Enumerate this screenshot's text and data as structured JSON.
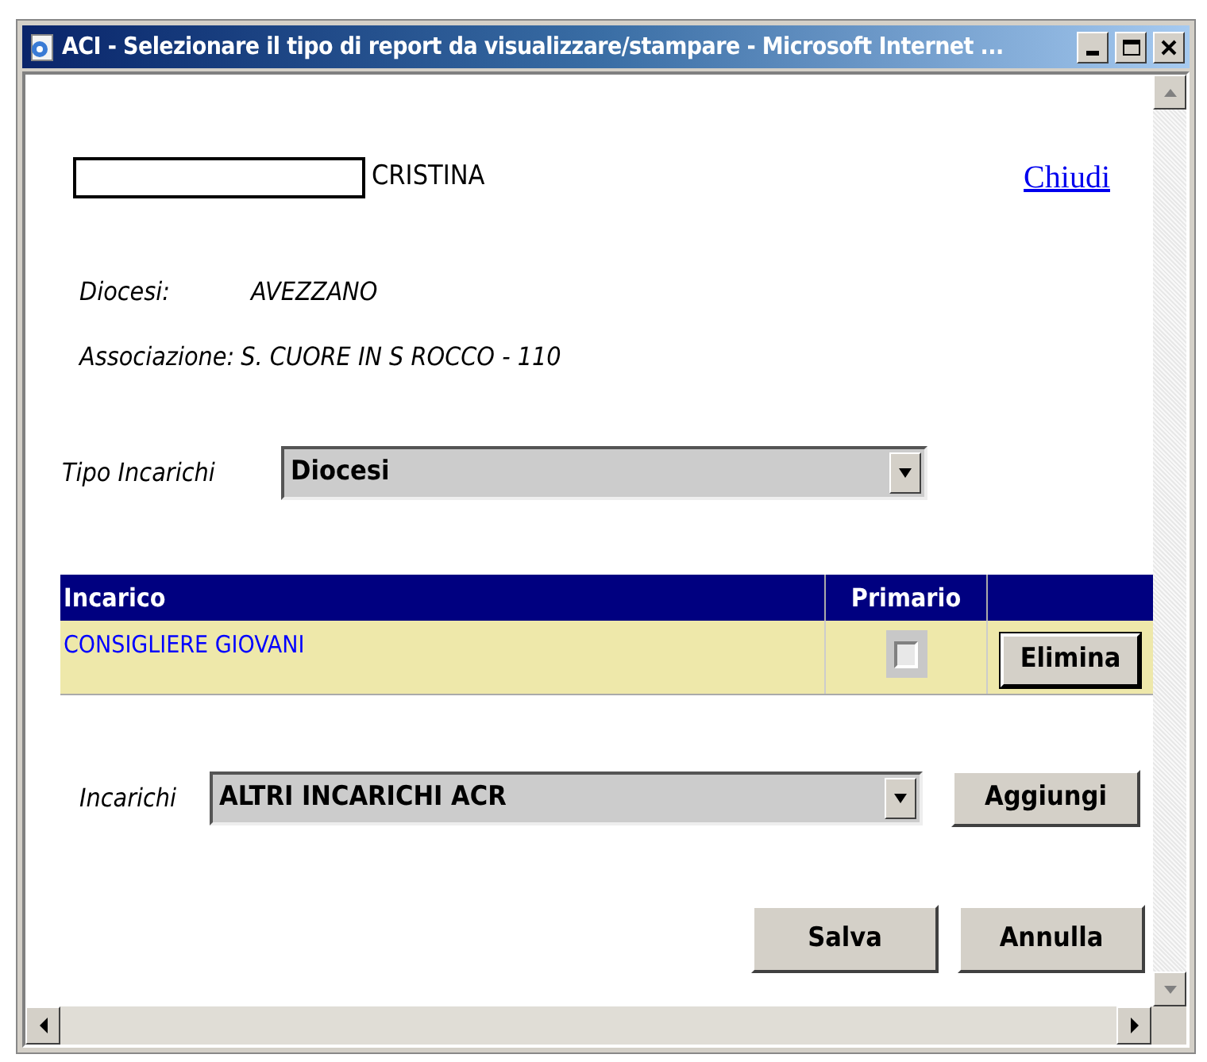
{
  "window": {
    "title": "ACI - Selezionare il tipo di report da visualizzare/stampare - Microsoft Internet ..."
  },
  "person": {
    "first_name": "CRISTINA"
  },
  "close_link": "Chiudi",
  "info": [
    {
      "label": "Diocesi:",
      "value": "AVEZZANO"
    },
    {
      "label": "Associazione:",
      "value": "S. CUORE IN S ROCCO - 110"
    }
  ],
  "tipo_incarichi": {
    "label": "Tipo Incarichi",
    "value": "Diocesi"
  },
  "table": {
    "columns": [
      "Incarico",
      "Primario"
    ],
    "rows": [
      {
        "incarico": "CONSIGLIERE GIOVANI",
        "primario": false,
        "action": "Elimina"
      }
    ]
  },
  "incarichi": {
    "label": "Incarichi",
    "value": "ALTRI INCARICHI ACR",
    "button": "Aggiungi"
  },
  "buttons": [
    "Salva",
    "Annulla"
  ]
}
